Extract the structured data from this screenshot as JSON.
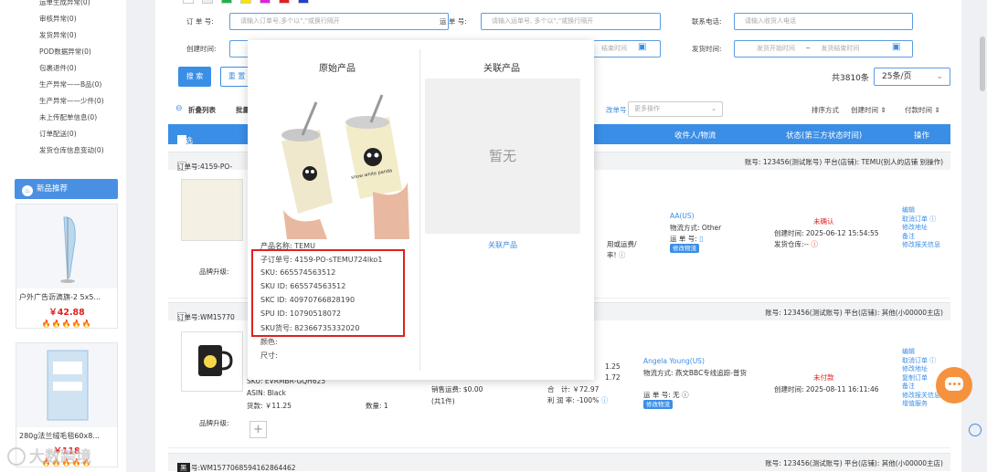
{
  "sidebar": {
    "items": [
      "运单生成异常(0)",
      "审核异常(0)",
      "发货异常(0)",
      "POD数据异常(0)",
      "包裹退件(0)",
      "生产异常——B品(0)",
      "生产异常——少件(0)",
      "未上传配单信息(0)",
      "订单配送(0)",
      "发货仓库信息变动(0)"
    ],
    "promo_title": "新品推荐",
    "products": [
      {
        "name": "户外广告沥滴旗-2 5x5...",
        "price": "￥42.88",
        "flames": "🔥🔥🔥🔥🔥"
      },
      {
        "name": "280g法兰绒毛毯60x8...",
        "price": "￥118",
        "flames": "🔥🔥🔥🔥🔥"
      }
    ],
    "watermark": "大数跨境"
  },
  "filters": {
    "order_no_label": "订 单 号:",
    "order_no_placeholder": "请输入订单号,多个以\",\"或换行隔开",
    "waybill_label": "运 单 号:",
    "waybill_placeholder": "请输入运单号, 多个以\",\"或换行隔开",
    "phone_label": "联系电话:",
    "phone_placeholder": "请输入收货人电话",
    "created_label": "创建时间:",
    "created_end_placeholder": "结束时间",
    "shipped_label": "发货时间:",
    "shipped_start_placeholder": "发货开始时间",
    "shipped_sep": "~",
    "shipped_end_placeholder": "发货结束时间",
    "search_btn": "搜 索",
    "reset_btn": "重 置"
  },
  "pagination": {
    "total": "共3810条",
    "page_size": "25条/页"
  },
  "toolbar": {
    "collapse": "折叠列表",
    "batch": "批量",
    "mod_no": "改单号",
    "more_ops": "更多操作",
    "sort_label": "排序方式",
    "sort_created": "创建时间",
    "sort_paid": "付款时间"
  },
  "table": {
    "select_all": "全选",
    "col_recipient": "收件人/物流",
    "col_status": "状态(第三方状态时间)",
    "col_ops": "操作"
  },
  "orders": [
    {
      "order_no": "订单号:4159-PO-",
      "account": "账号: 123456(测试账号) 平台(店铺): TEMU(别人的店铺 别操作)",
      "brand_upgrade": "品牌升级:",
      "fee_text": "用或运费/",
      "fee_text2": "率!",
      "recipient": "AA(US)",
      "logistics": "物流方式: Other",
      "waybill": "运 单 号:",
      "modify_logistics": "修改物流",
      "status": "未确认",
      "created": "创建时间: 2025-06-12 15:54:55",
      "warehouse": "发货仓库:--",
      "actions": [
        "编辑",
        "取消订单",
        "修改地址",
        "备注",
        "修改报关信息"
      ]
    },
    {
      "order_no": "订单号:WM15770",
      "account": "账号: 123456(测试账号) 平台(店铺): 其他(小00000主店)",
      "sku": "SKU: EVRMBR-GQH625",
      "asin": "ASIN: Black",
      "price": "货款: ￥11.25",
      "qty": "数量: 1",
      "brand_upgrade": "品牌升级:",
      "sales_shipping": "销售运费: $0.00",
      "count": "(共1件)",
      "amt1": "1.25",
      "amt2": "1.72",
      "total": "合　计: ￥72.97",
      "profit": "利 润 率: -100%",
      "recipient": "Angela Young(US)",
      "logistics": "物流方式: 燕文BBC专线追踪-普货",
      "waybill": "运 单 号: 无",
      "modify_logistics": "修改物流",
      "status": "未付款",
      "created": "创建时间: 2025-08-11 16:11:46",
      "actions": [
        "编辑",
        "取消订单",
        "修改地址",
        "复制订单",
        "备注",
        "修改报关信息",
        "增值服务"
      ]
    },
    {
      "order_no": "订单号:WM1577068594162864462",
      "tag": "黑",
      "account": "账号: 123456(测试账号) 平台(店铺): 其他(小00000主店)"
    }
  ],
  "popup": {
    "original_title": "原始产品",
    "linked_title": "关联产品",
    "no_data": "暂无",
    "linked_link": "关联产品",
    "product_name": "产品名称: TEMU",
    "sub_order": "子订单号: 4159-PO-sTEMU724lko1",
    "sku": "SKU: 665574563512",
    "sku_id": "SKU ID: 665574563512",
    "skc_id": "SKC ID: 40970766828190",
    "spu_id": "SPU ID: 10790518072",
    "sku_code": "SKU货号: 82366735332020",
    "color": "颜色:",
    "size": "尺寸:",
    "mug_text": "snow white panda"
  },
  "colors": {
    "accent": "#3a8ee6",
    "highlight": "#e02020",
    "chat": "#f5923e"
  }
}
